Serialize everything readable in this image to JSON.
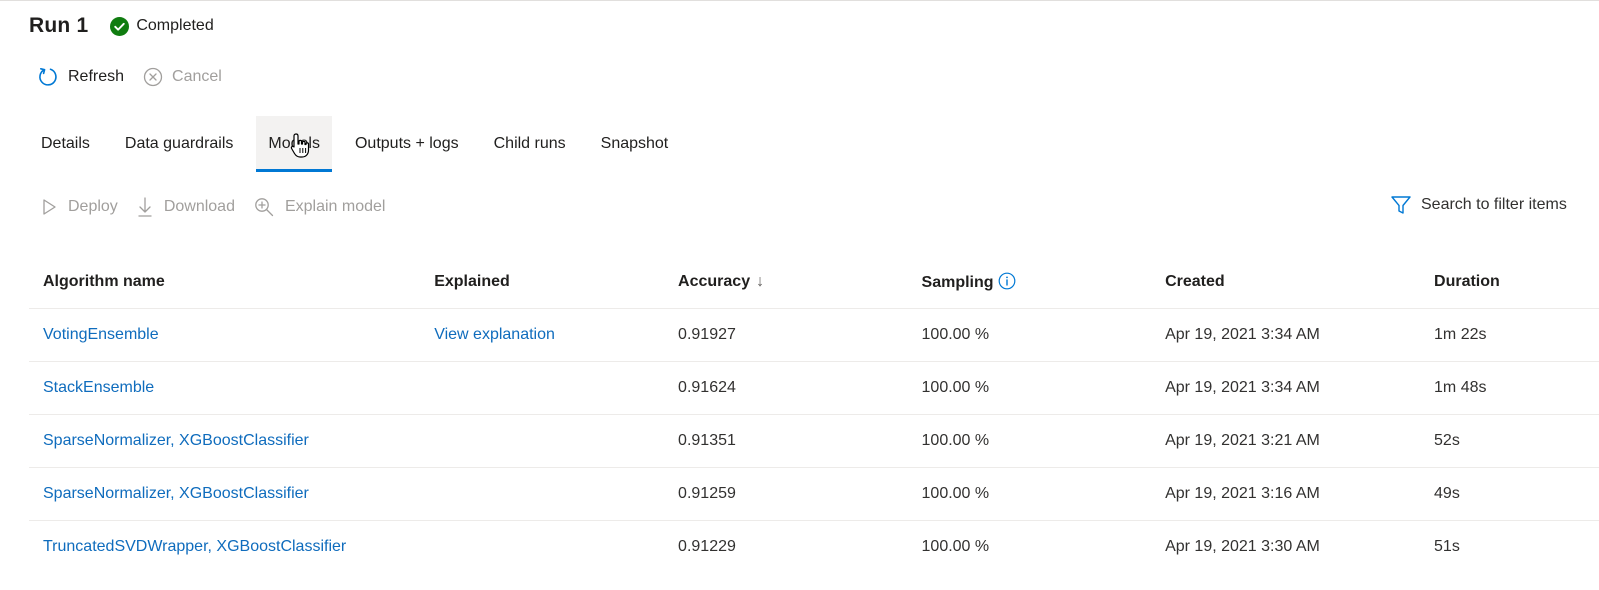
{
  "run": {
    "title": "Run 1",
    "status": "Completed"
  },
  "commands": {
    "refresh": "Refresh",
    "cancel": "Cancel"
  },
  "tabs": [
    {
      "label": "Details"
    },
    {
      "label": "Data guardrails"
    },
    {
      "label": "Models"
    },
    {
      "label": "Outputs + logs"
    },
    {
      "label": "Child runs"
    },
    {
      "label": "Snapshot"
    }
  ],
  "active_tab": "Models",
  "model_actions": {
    "deploy": "Deploy",
    "download": "Download",
    "explain": "Explain model"
  },
  "filter": {
    "placeholder": "Search to filter items"
  },
  "table": {
    "headers": {
      "algorithm": "Algorithm name",
      "explained": "Explained",
      "accuracy": "Accuracy",
      "sort_indicator": "↓",
      "sampling": "Sampling",
      "created": "Created",
      "duration": "Duration"
    },
    "rows": [
      {
        "algorithm": "VotingEnsemble",
        "explained": "View explanation",
        "accuracy": "0.91927",
        "sampling": "100.00 %",
        "created": "Apr 19, 2021 3:34 AM",
        "duration": "1m 22s"
      },
      {
        "algorithm": "StackEnsemble",
        "explained": "",
        "accuracy": "0.91624",
        "sampling": "100.00 %",
        "created": "Apr 19, 2021 3:34 AM",
        "duration": "1m 48s"
      },
      {
        "algorithm": "SparseNormalizer, XGBoostClassifier",
        "explained": "",
        "accuracy": "0.91351",
        "sampling": "100.00 %",
        "created": "Apr 19, 2021 3:21 AM",
        "duration": "52s"
      },
      {
        "algorithm": "SparseNormalizer, XGBoostClassifier",
        "explained": "",
        "accuracy": "0.91259",
        "sampling": "100.00 %",
        "created": "Apr 19, 2021 3:16 AM",
        "duration": "49s"
      },
      {
        "algorithm": "TruncatedSVDWrapper, XGBoostClassifier",
        "explained": "",
        "accuracy": "0.91229",
        "sampling": "100.00 %",
        "created": "Apr 19, 2021 3:30 AM",
        "duration": "51s"
      }
    ]
  },
  "colors": {
    "accent": "#0078d4",
    "link": "#0f6cbd",
    "success": "#107c10",
    "disabled": "#a19f9d"
  }
}
